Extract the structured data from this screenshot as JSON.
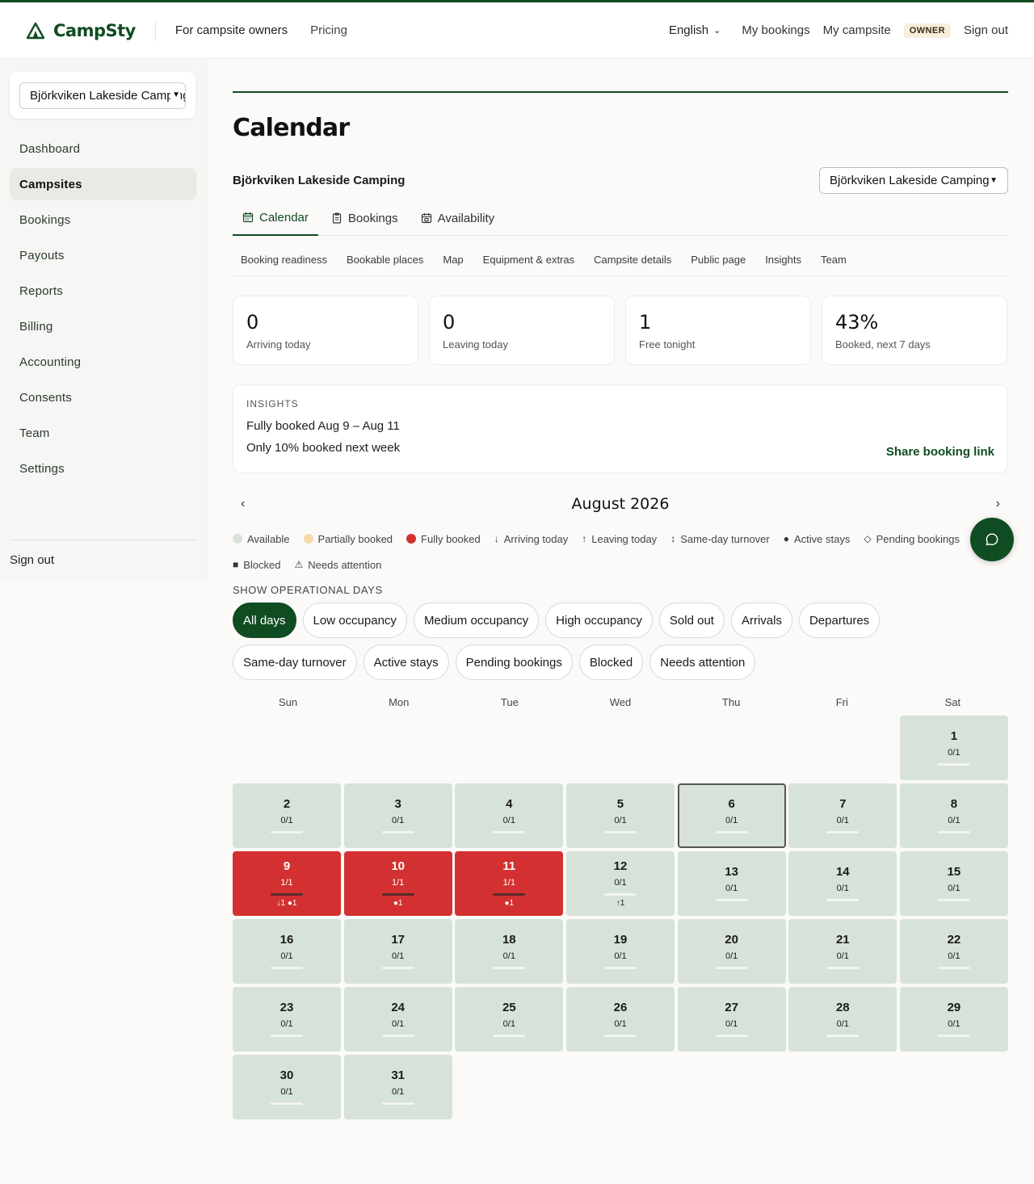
{
  "header": {
    "brand": "CampSty",
    "links": [
      "For campsite owners",
      "Pricing"
    ],
    "language": "English",
    "my_bookings": "My bookings",
    "my_campsite": "My campsite",
    "role_badge": "OWNER",
    "sign_out": "Sign out"
  },
  "sidebar": {
    "campsite_select": "Björkviken Lakeside Camping",
    "items": [
      {
        "label": "Dashboard",
        "active": false
      },
      {
        "label": "Campsites",
        "active": true
      },
      {
        "label": "Bookings",
        "active": false
      },
      {
        "label": "Payouts",
        "active": false
      },
      {
        "label": "Reports",
        "active": false
      },
      {
        "label": "Billing",
        "active": false
      },
      {
        "label": "Accounting",
        "active": false
      },
      {
        "label": "Consents",
        "active": false
      },
      {
        "label": "Team",
        "active": false
      },
      {
        "label": "Settings",
        "active": false
      }
    ],
    "sign_out": "Sign out"
  },
  "page": {
    "title": "Calendar",
    "campsite_name": "Björkviken Lakeside Camping",
    "campsite_select": "Björkviken Lakeside Camping"
  },
  "tabs": [
    {
      "label": "Calendar",
      "icon": "calendar-icon",
      "active": true
    },
    {
      "label": "Bookings",
      "icon": "clipboard-icon",
      "active": false
    },
    {
      "label": "Availability",
      "icon": "calendar-grid-icon",
      "active": false
    }
  ],
  "subtabs": [
    "Booking readiness",
    "Bookable places",
    "Map",
    "Equipment & extras",
    "Campsite details",
    "Public page",
    "Insights",
    "Team"
  ],
  "stats": [
    {
      "value": "0",
      "label": "Arriving today"
    },
    {
      "value": "0",
      "label": "Leaving today"
    },
    {
      "value": "1",
      "label": "Free tonight"
    },
    {
      "value": "43%",
      "label": "Booked, next 7 days"
    }
  ],
  "insights": {
    "heading": "INSIGHTS",
    "lines": [
      "Fully booked Aug 9 – Aug 11",
      "Only 10% booked next week"
    ],
    "share_link": "Share booking link"
  },
  "calendar": {
    "prev": "‹",
    "next": "›",
    "month": "August 2026",
    "legend": [
      {
        "label": "Available",
        "symbol": "dot",
        "color": "#d7e2d9"
      },
      {
        "label": "Partially booked",
        "symbol": "dot",
        "color": "#f6d8a8"
      },
      {
        "label": "Fully booked",
        "symbol": "dot",
        "color": "#d33131"
      },
      {
        "label": "Arriving today",
        "symbol": "↓"
      },
      {
        "label": "Leaving today",
        "symbol": "↑"
      },
      {
        "label": "Same-day turnover",
        "symbol": "↕"
      },
      {
        "label": "Active stays",
        "symbol": "●"
      },
      {
        "label": "Pending bookings",
        "symbol": "◇"
      },
      {
        "label": "Blocked",
        "symbol": "■"
      },
      {
        "label": "Needs attention",
        "symbol": "⚠"
      }
    ],
    "filter_heading": "SHOW OPERATIONAL DAYS",
    "filters": [
      {
        "label": "All days",
        "active": true
      },
      {
        "label": "Low occupancy",
        "active": false
      },
      {
        "label": "Medium occupancy",
        "active": false
      },
      {
        "label": "High occupancy",
        "active": false
      },
      {
        "label": "Sold out",
        "active": false
      },
      {
        "label": "Arrivals",
        "active": false
      },
      {
        "label": "Departures",
        "active": false
      },
      {
        "label": "Same-day turnover",
        "active": false
      },
      {
        "label": "Active stays",
        "active": false
      },
      {
        "label": "Pending bookings",
        "active": false
      },
      {
        "label": "Blocked",
        "active": false
      },
      {
        "label": "Needs attention",
        "active": false
      }
    ],
    "weekdays": [
      "Sun",
      "Mon",
      "Tue",
      "Wed",
      "Thu",
      "Fri",
      "Sat"
    ],
    "first_weekday_index": 6,
    "days": [
      {
        "day": "1",
        "occupancy": "0/1",
        "status": "available"
      },
      {
        "day": "2",
        "occupancy": "0/1",
        "status": "available"
      },
      {
        "day": "3",
        "occupancy": "0/1",
        "status": "available"
      },
      {
        "day": "4",
        "occupancy": "0/1",
        "status": "available"
      },
      {
        "day": "5",
        "occupancy": "0/1",
        "status": "available"
      },
      {
        "day": "6",
        "occupancy": "0/1",
        "status": "available",
        "today": true
      },
      {
        "day": "7",
        "occupancy": "0/1",
        "status": "available"
      },
      {
        "day": "8",
        "occupancy": "0/1",
        "status": "available"
      },
      {
        "day": "9",
        "occupancy": "1/1",
        "status": "full",
        "marks": "↓1 ●1"
      },
      {
        "day": "10",
        "occupancy": "1/1",
        "status": "full",
        "marks": "●1"
      },
      {
        "day": "11",
        "occupancy": "1/1",
        "status": "full",
        "marks": "●1"
      },
      {
        "day": "12",
        "occupancy": "0/1",
        "status": "available",
        "marks": "↑1"
      },
      {
        "day": "13",
        "occupancy": "0/1",
        "status": "available"
      },
      {
        "day": "14",
        "occupancy": "0/1",
        "status": "available"
      },
      {
        "day": "15",
        "occupancy": "0/1",
        "status": "available"
      },
      {
        "day": "16",
        "occupancy": "0/1",
        "status": "available"
      },
      {
        "day": "17",
        "occupancy": "0/1",
        "status": "available"
      },
      {
        "day": "18",
        "occupancy": "0/1",
        "status": "available"
      },
      {
        "day": "19",
        "occupancy": "0/1",
        "status": "available"
      },
      {
        "day": "20",
        "occupancy": "0/1",
        "status": "available"
      },
      {
        "day": "21",
        "occupancy": "0/1",
        "status": "available"
      },
      {
        "day": "22",
        "occupancy": "0/1",
        "status": "available"
      },
      {
        "day": "23",
        "occupancy": "0/1",
        "status": "available"
      },
      {
        "day": "24",
        "occupancy": "0/1",
        "status": "available"
      },
      {
        "day": "25",
        "occupancy": "0/1",
        "status": "available"
      },
      {
        "day": "26",
        "occupancy": "0/1",
        "status": "available"
      },
      {
        "day": "27",
        "occupancy": "0/1",
        "status": "available"
      },
      {
        "day": "28",
        "occupancy": "0/1",
        "status": "available"
      },
      {
        "day": "29",
        "occupancy": "0/1",
        "status": "available"
      },
      {
        "day": "30",
        "occupancy": "0/1",
        "status": "available"
      },
      {
        "day": "31",
        "occupancy": "0/1",
        "status": "available"
      }
    ]
  },
  "chat_button": {
    "icon": "chat-bubble-icon"
  },
  "colors": {
    "brand": "#104c22",
    "available": "#d7e2d9",
    "fully_booked": "#d33131",
    "owner_badge": "#f9eedc"
  }
}
